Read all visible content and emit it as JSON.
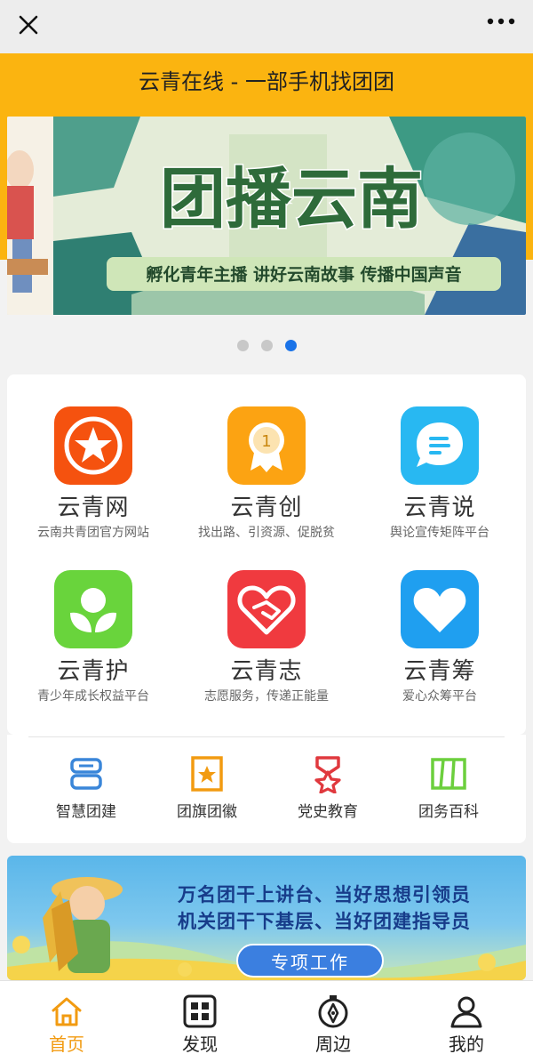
{
  "title": "云青在线 - 一部手机找团团",
  "banner": {
    "headline": "团播云南",
    "tagline": "孵化青年主播  讲好云南故事  传播中国声音",
    "dots": 3,
    "active_dot": 2
  },
  "tiles": [
    {
      "name": "云青网",
      "sub": "云南共青团官方网站",
      "icon": "star-badge-icon",
      "color": "#f5520f"
    },
    {
      "name": "云青创",
      "sub": "找出路、引资源、促脱贫",
      "icon": "medal-icon",
      "color": "#fca312"
    },
    {
      "name": "云青说",
      "sub": "舆论宣传矩阵平台",
      "icon": "chat-bubble-icon",
      "color": "#28b8f2"
    },
    {
      "name": "云青护",
      "sub": "青少年成长权益平台",
      "icon": "sprout-icon",
      "color": "#69d43c"
    },
    {
      "name": "云青志",
      "sub": "志愿服务，传递正能量",
      "icon": "heart-hand-icon",
      "color": "#f03a3f"
    },
    {
      "name": "云青筹",
      "sub": "爱心众筹平台",
      "icon": "heart-icon",
      "color": "#1f9ff0"
    }
  ],
  "quick": [
    {
      "label": "智慧团建",
      "icon": "smart-build-icon",
      "color": "#3a86d9"
    },
    {
      "label": "团旗团徽",
      "icon": "flag-badge-icon",
      "color": "#f29b11"
    },
    {
      "label": "党史教育",
      "icon": "party-history-icon",
      "color": "#e0393e"
    },
    {
      "label": "团务百科",
      "icon": "book-shelf-icon",
      "color": "#6ccf3d"
    }
  ],
  "promo": {
    "line1": "万名团干上讲台、当好思想引领员",
    "line2": "机关团干下基层、当好团建指导员",
    "button": "专项工作"
  },
  "tabs": [
    {
      "label": "首页",
      "icon": "home-icon"
    },
    {
      "label": "发现",
      "icon": "grid-icon"
    },
    {
      "label": "周边",
      "icon": "compass-icon"
    },
    {
      "label": "我的",
      "icon": "person-icon"
    }
  ],
  "colors": {
    "accent": "#fbb410",
    "tab_active": "#f29b11",
    "dot_active": "#1a73e8"
  }
}
